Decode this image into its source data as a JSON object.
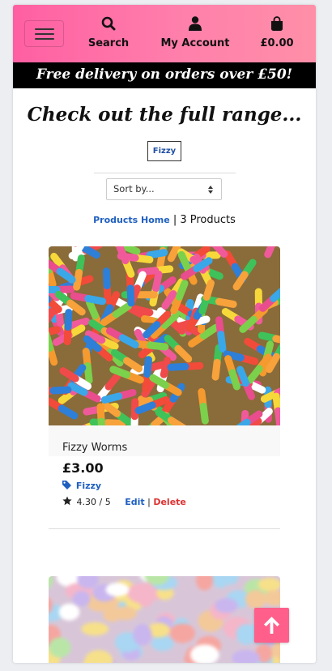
{
  "nav": {
    "menu_icon": "hamburger-icon",
    "search": {
      "label": "Search",
      "icon": "search-icon"
    },
    "account": {
      "label": "My Account",
      "icon": "user-icon"
    },
    "cart": {
      "label": "£0.00",
      "icon": "shopping-bag-icon"
    }
  },
  "banner": {
    "text": "Free delivery on orders over £50!"
  },
  "page": {
    "title": "Check out the full range...",
    "tag": "Fizzy",
    "sort": {
      "value": "Sort by..."
    },
    "breadcrumb": {
      "link": "Products Home",
      "separator": "|",
      "count": "3 Products"
    }
  },
  "products": [
    {
      "name": "Fizzy Worms",
      "price": "£3.00",
      "category": "Fizzy",
      "rating": "4.30 / 5",
      "edit_label": "Edit",
      "delete_label": "Delete"
    }
  ],
  "colors": {
    "header_pink": "#ff5fa2",
    "link_blue": "#1f5fc0",
    "delete_red": "#d33333",
    "back_to_top": "#ff5f8a"
  }
}
